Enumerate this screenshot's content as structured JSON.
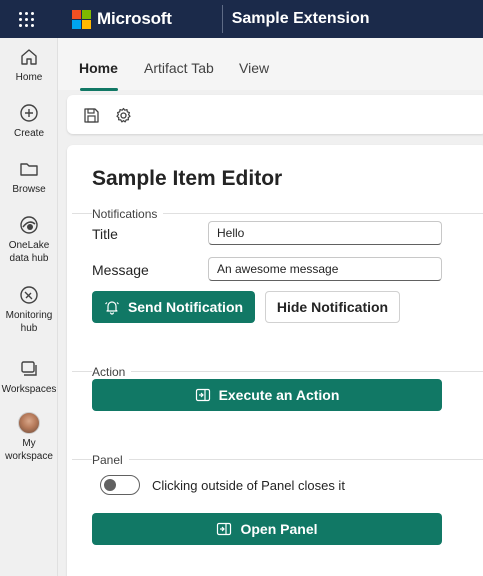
{
  "header": {
    "brand": "Microsoft",
    "app_title": "Sample Extension",
    "logo_colors": [
      "#f25022",
      "#7fba00",
      "#00a4ef",
      "#ffb900"
    ]
  },
  "rail": {
    "items": [
      {
        "label": "Home",
        "icon": "home-icon"
      },
      {
        "label": "Create",
        "icon": "create-icon"
      },
      {
        "label": "Browse",
        "icon": "folder-icon"
      },
      {
        "label": "OneLake data hub",
        "icon": "onelake-icon"
      },
      {
        "label": "Monitoring hub",
        "icon": "monitoring-icon"
      },
      {
        "label": "Workspaces",
        "icon": "workspaces-icon"
      },
      {
        "label": "My workspace",
        "icon": "avatar"
      }
    ]
  },
  "tabs": [
    {
      "label": "Home",
      "active": true
    },
    {
      "label": "Artifact Tab",
      "active": false
    },
    {
      "label": "View",
      "active": false
    }
  ],
  "toolbar": {
    "items": [
      "save-icon",
      "settings-icon"
    ]
  },
  "editor": {
    "title": "Sample Item Editor",
    "notifications": {
      "section_label": "Notifications",
      "title_label": "Title",
      "title_value": "Hello",
      "message_label": "Message",
      "message_value": "An awesome message",
      "send_label": "Send Notification",
      "hide_label": "Hide Notification"
    },
    "action": {
      "section_label": "Action",
      "execute_label": "Execute an Action"
    },
    "panel": {
      "section_label": "Panel",
      "toggle_label": "Clicking outside of Panel closes it",
      "toggle_on": false,
      "open_label": "Open Panel"
    }
  },
  "colors": {
    "accent": "#117865",
    "header_bg": "#1b2a4a"
  }
}
